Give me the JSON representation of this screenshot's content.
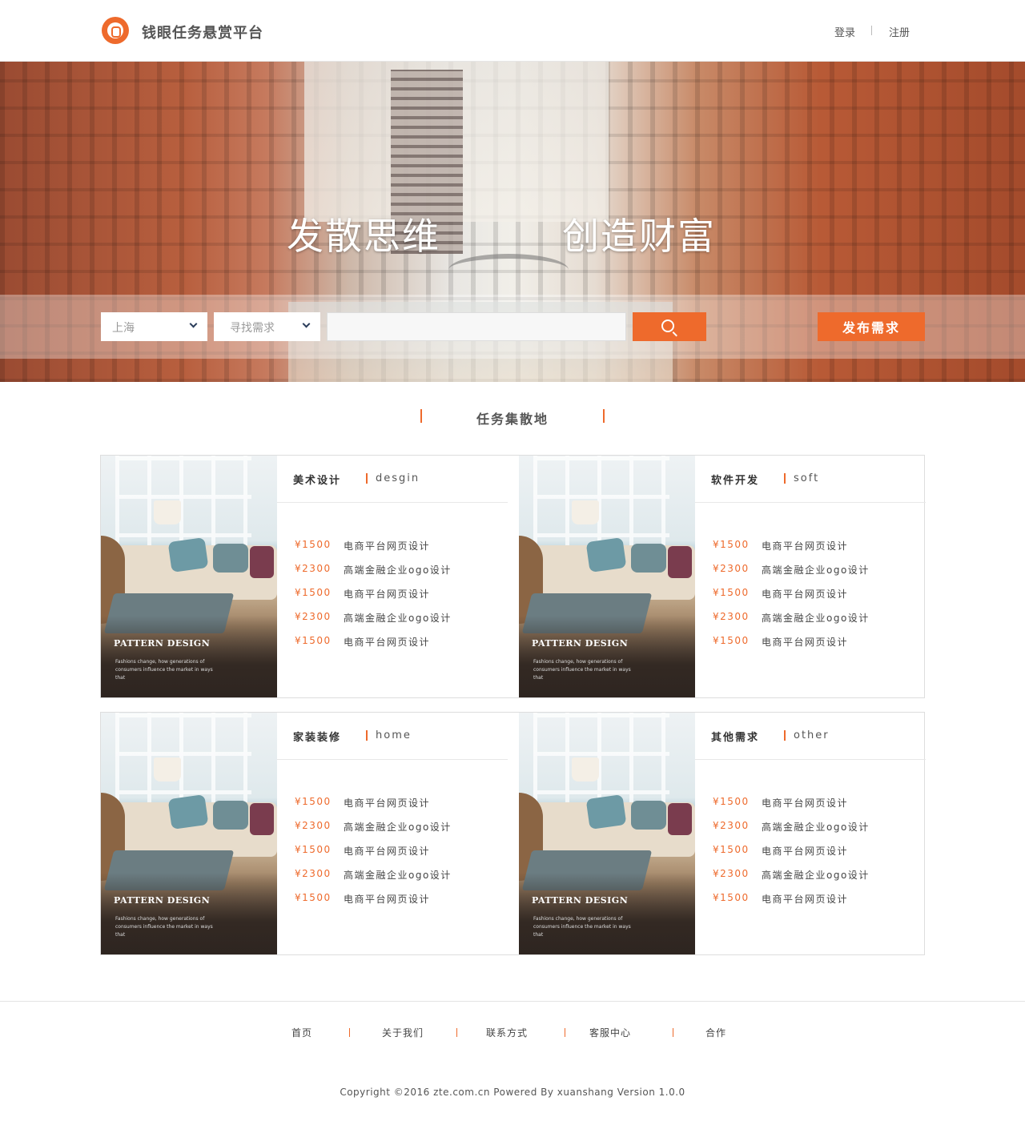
{
  "header": {
    "site_title": "钱眼任务悬赏平台",
    "login": "登录",
    "register": "注册"
  },
  "banner": {
    "slogan_left": "发散思维",
    "slogan_right": "创造财富",
    "city_select": "上海",
    "need_select": "寻找需求",
    "search_placeholder": "",
    "publish_button": "发布需求"
  },
  "section": {
    "title": "任务集散地"
  },
  "card_image": {
    "title": "PATTERN DESIGN",
    "text": "Fashions change, how generations of consumers influence the market in ways that"
  },
  "categories": [
    {
      "cn": "美术设计",
      "en": "desgin",
      "tasks": [
        {
          "price": "¥1500",
          "name": "电商平台网页设计"
        },
        {
          "price": "¥2300",
          "name": "高端金融企业ogo设计"
        },
        {
          "price": "¥1500",
          "name": "电商平台网页设计"
        },
        {
          "price": "¥2300",
          "name": "高端金融企业ogo设计"
        },
        {
          "price": "¥1500",
          "name": "电商平台网页设计"
        }
      ]
    },
    {
      "cn": "软件开发",
      "en": "soft",
      "tasks": [
        {
          "price": "¥1500",
          "name": "电商平台网页设计"
        },
        {
          "price": "¥2300",
          "name": "高端金融企业ogo设计"
        },
        {
          "price": "¥1500",
          "name": "电商平台网页设计"
        },
        {
          "price": "¥2300",
          "name": "高端金融企业ogo设计"
        },
        {
          "price": "¥1500",
          "name": "电商平台网页设计"
        }
      ]
    },
    {
      "cn": "家装装修",
      "en": "home",
      "tasks": [
        {
          "price": "¥1500",
          "name": "电商平台网页设计"
        },
        {
          "price": "¥2300",
          "name": "高端金融企业ogo设计"
        },
        {
          "price": "¥1500",
          "name": "电商平台网页设计"
        },
        {
          "price": "¥2300",
          "name": "高端金融企业ogo设计"
        },
        {
          "price": "¥1500",
          "name": "电商平台网页设计"
        }
      ]
    },
    {
      "cn": "其他需求",
      "en": "other",
      "tasks": [
        {
          "price": "¥1500",
          "name": "电商平台网页设计"
        },
        {
          "price": "¥2300",
          "name": "高端金融企业ogo设计"
        },
        {
          "price": "¥1500",
          "name": "电商平台网页设计"
        },
        {
          "price": "¥2300",
          "name": "高端金融企业ogo设计"
        },
        {
          "price": "¥1500",
          "name": "电商平台网页设计"
        }
      ]
    }
  ],
  "footer": {
    "links": [
      "首页",
      "关于我们",
      "联系方式",
      "客服中心",
      "合作"
    ],
    "copyright": "Copyright ©2016 zte.com.cn Powered By xuanshang Version 1.0.0"
  },
  "colors": {
    "accent": "#ee6a2c",
    "text": "#333333",
    "border": "#dddddd"
  }
}
